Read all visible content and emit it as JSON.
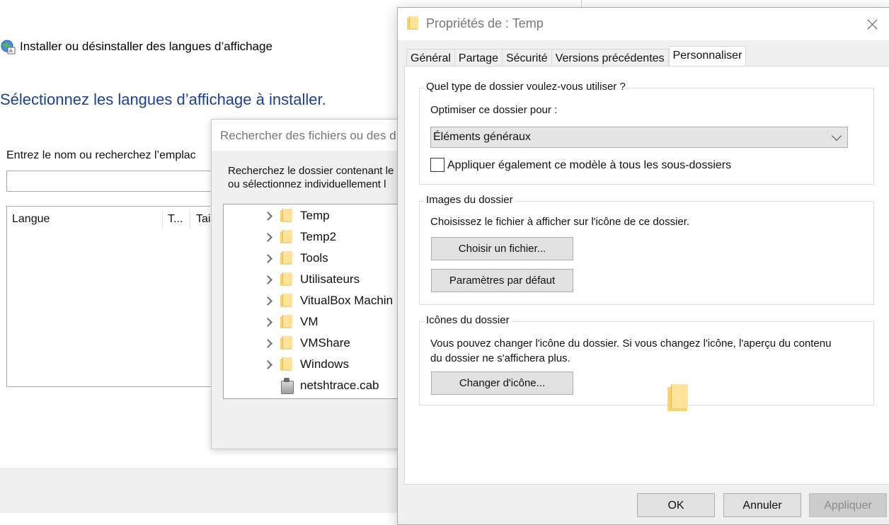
{
  "lang_window": {
    "header_title": "Installer ou désinstaller des langues d’affichage",
    "heading": "Sélectionnez les langues d’affichage à installer.",
    "prompt": "Entrez le nom ou recherchez l’emplac",
    "search_value": "",
    "columns": [
      "Langue",
      "T...",
      "Tail"
    ]
  },
  "browse_window": {
    "title": "Rechercher des fichiers ou des d",
    "instruction_line1": "Recherchez le dossier contenant le",
    "instruction_line2": "ou sélectionnez individuellement l",
    "tree": [
      {
        "label": "Temp",
        "type": "folder"
      },
      {
        "label": "Temp2",
        "type": "folder"
      },
      {
        "label": "Tools",
        "type": "folder"
      },
      {
        "label": "Utilisateurs",
        "type": "folder"
      },
      {
        "label": "VitualBox Machin",
        "type": "folder"
      },
      {
        "label": "VM",
        "type": "folder"
      },
      {
        "label": "VMShare",
        "type": "folder"
      },
      {
        "label": "Windows",
        "type": "folder"
      },
      {
        "label": "netshtrace.cab",
        "type": "cab"
      }
    ]
  },
  "props_window": {
    "title": "Propriétés de : Temp",
    "tabs": [
      "Général",
      "Partage",
      "Sécurité",
      "Versions précédentes",
      "Personnaliser"
    ],
    "active_tab": "Personnaliser",
    "group_type": {
      "legend": "Quel type de dossier voulez-vous utiliser ?",
      "optimize_label": "Optimiser ce dossier pour :",
      "optimize_value": "Éléments généraux",
      "apply_checkbox_label": "Appliquer également ce modèle à tous les sous-dossiers",
      "apply_checked": false
    },
    "group_images": {
      "legend": "Images du dossier",
      "description": "Choisissez le fichier à afficher sur l'icône de ce dossier.",
      "choose_button": "Choisir un fichier...",
      "default_button": "Paramètres par défaut"
    },
    "group_icons": {
      "legend": "Icônes du dossier",
      "description_line1": "Vous pouvez changer l'icône du dossier. Si vous changez l'icône, l'aperçu du contenu",
      "description_line2": "du dossier ne s'affichera plus.",
      "change_button": "Changer d'icône..."
    },
    "footer": {
      "ok": "OK",
      "cancel": "Annuler",
      "apply": "Appliquer"
    }
  },
  "colors": {
    "heading_blue": "#1a3f9e",
    "folder_yellow": "#f8d470",
    "dialog_bg": "#f0f0f0"
  }
}
